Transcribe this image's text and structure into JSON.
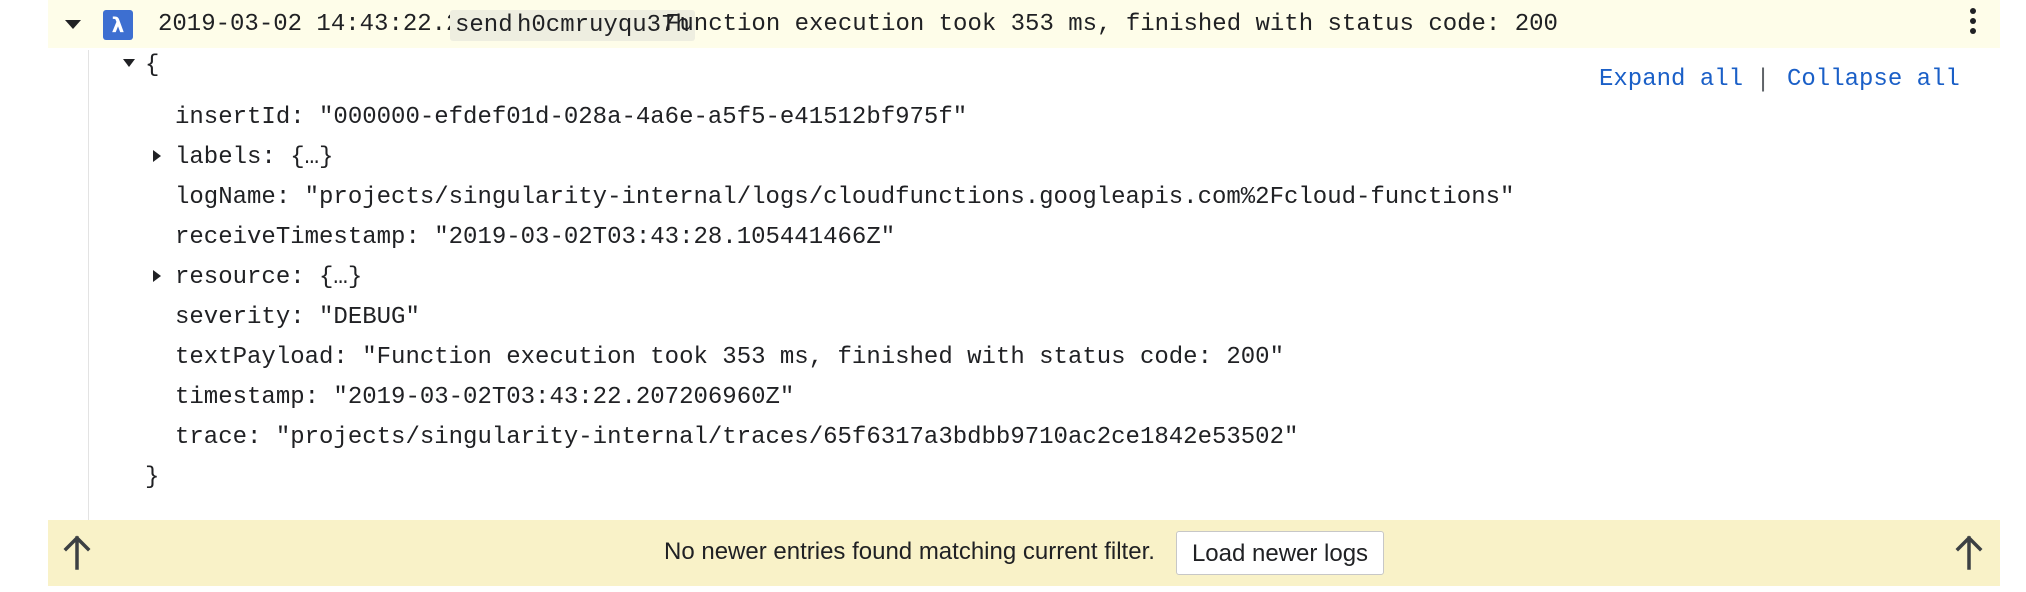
{
  "entry": {
    "timestamp": "2019-03-02 14:43:22.207 AEDT",
    "function_chip": "send",
    "execution_chip": "h0cmruyqu37h",
    "summary": "Function execution took 353 ms, finished with status code: 200",
    "badge_glyph": "λ",
    "menu_icon": "more-vert-icon"
  },
  "payload": {
    "open_brace": "{",
    "close_brace": "}",
    "expand_all_label": "Expand all",
    "collapse_all_label": "Collapse all",
    "separator": "|",
    "fields": [
      {
        "text": "insertId: \"000000-efdef01d-028a-4a6e-a5f5-e41512bf975f\"",
        "expandable": false
      },
      {
        "text": "labels: {…}",
        "expandable": true
      },
      {
        "text": "logName: \"projects/singularity-internal/logs/cloudfunctions.googleapis.com%2Fcloud-functions\"",
        "expandable": false
      },
      {
        "text": "receiveTimestamp: \"2019-03-02T03:43:28.105441466Z\"",
        "expandable": false
      },
      {
        "text": "resource: {…}",
        "expandable": true
      },
      {
        "text": "severity: \"DEBUG\"",
        "expandable": false
      },
      {
        "text": "textPayload: \"Function execution took 353 ms, finished with status code: 200\"",
        "expandable": false
      },
      {
        "text": "timestamp: \"2019-03-02T03:43:22.207206960Z\"",
        "expandable": false
      },
      {
        "text": "trace: \"projects/singularity-internal/traces/65f6317a3bdbb9710ac2ce1842e53502\"",
        "expandable": false
      }
    ]
  },
  "footer": {
    "message": "No newer entries found matching current filter.",
    "load_button_label": "Load newer logs"
  },
  "colors": {
    "header_bg": "#fefde9",
    "footer_bg": "#f9f2c8",
    "badge": "#3d6fd1",
    "link": "#1a5fc7"
  }
}
